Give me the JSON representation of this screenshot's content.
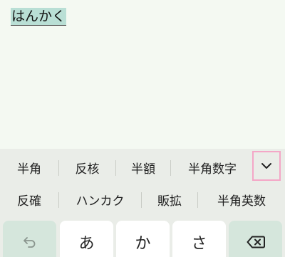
{
  "editor": {
    "composing_text": "はんかく"
  },
  "candidates": {
    "row1": [
      "半角",
      "反核",
      "半額",
      "半角数字"
    ],
    "row2": [
      "反確",
      "ハンカク",
      "販拡",
      "半角英数"
    ],
    "expand_icon": "chevron-down-icon"
  },
  "keys": {
    "undo_icon": "undo-icon",
    "a": "あ",
    "ka": "か",
    "sa": "さ",
    "backspace_icon": "backspace-icon"
  },
  "colors": {
    "composing_highlight": "#b9dfd5",
    "function_key": "#d5e6dc",
    "expand_border": "#f4a7c7"
  }
}
